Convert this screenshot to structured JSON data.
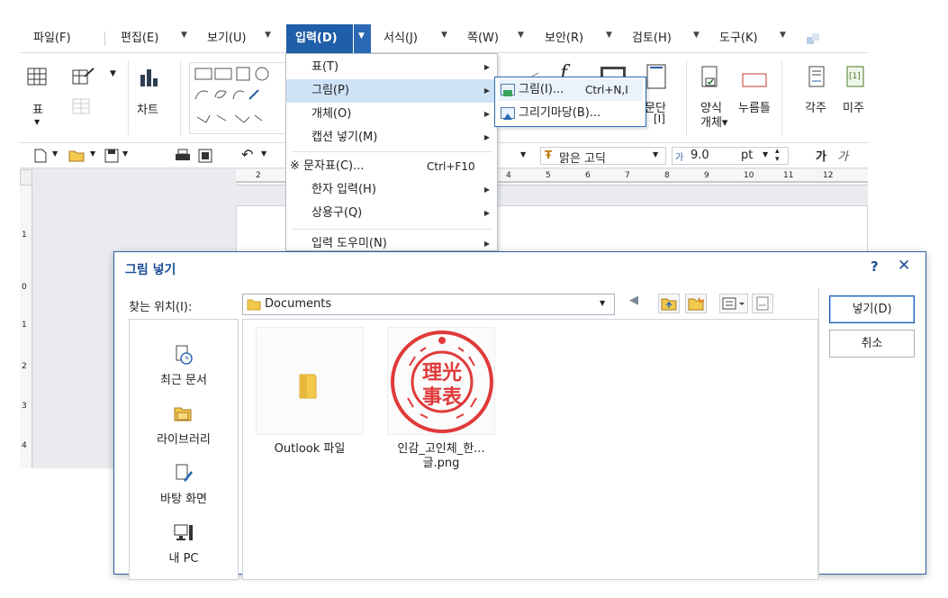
{
  "menubar": {
    "items": [
      "파일(F)",
      "편집(E)",
      "보기(U)",
      "입력(D)",
      "서식(J)",
      "쪽(W)",
      "보안(R)",
      "검토(H)",
      "도구(K)"
    ],
    "active": "입력(D)"
  },
  "ribbon": {
    "table_label": "표",
    "chart_label": "차트",
    "paragraph_label": "문단",
    "form_object_label": "양식",
    "form_object_label2": "개체▾",
    "button_label": "누름틀",
    "footnote_label": "각주",
    "endnote_label": "미주"
  },
  "toolbar": {
    "font_name": "맑은 고딕",
    "font_size": "9.0",
    "font_unit": "pt",
    "bold_label": "가",
    "italic_label": "가"
  },
  "ruler": {
    "top_ticks": [
      "2",
      "4",
      "5",
      "6",
      "7",
      "8",
      "9",
      "10",
      "11",
      "12"
    ],
    "left_ticks": [
      "1",
      "0",
      "1",
      "2",
      "3",
      "4"
    ]
  },
  "dropdown": {
    "items": [
      {
        "label": "표(T)",
        "shortcut": "",
        "submenu": true
      },
      {
        "label": "그림(P)",
        "shortcut": "",
        "submenu": true
      },
      {
        "label": "개체(O)",
        "shortcut": "",
        "submenu": true
      },
      {
        "label": "캡션 넣기(M)",
        "shortcut": "",
        "submenu": true
      },
      {
        "label": "※ 문자표(C)...",
        "shortcut": "Ctrl+F10",
        "submenu": false
      },
      {
        "label": "한자 입력(H)",
        "shortcut": "",
        "submenu": true
      },
      {
        "label": "상용구(Q)",
        "shortcut": "",
        "submenu": true
      },
      {
        "label": "입력 도우미(N)",
        "shortcut": "",
        "submenu": true
      }
    ]
  },
  "submenu": {
    "items": [
      {
        "label": "그림(I)...",
        "shortcut": "Ctrl+N,I"
      },
      {
        "label": "그리기마당(B)...",
        "shortcut": ""
      }
    ]
  },
  "dialog": {
    "title": "그림 넣기",
    "help": "?",
    "close": "✕",
    "lookin_label": "찾는 위치(I):",
    "lookin_value": "Documents",
    "places": [
      "최근 문서",
      "라이브러리",
      "바탕 화면",
      "내 PC"
    ],
    "files": [
      {
        "name": "Outlook 파일",
        "type": "folder"
      },
      {
        "name": "인감_고인체_한...",
        "name2": "글.png",
        "type": "image"
      }
    ],
    "seal_text": [
      "理光",
      "事表"
    ],
    "insert_button": "넣기(D)",
    "cancel_button": "취소"
  },
  "colors": {
    "accent": "#1f5ea8",
    "menu_highlight": "#cfe3f7",
    "dialog_title": "#1d4e93",
    "seal_red": "#e03a3a"
  }
}
